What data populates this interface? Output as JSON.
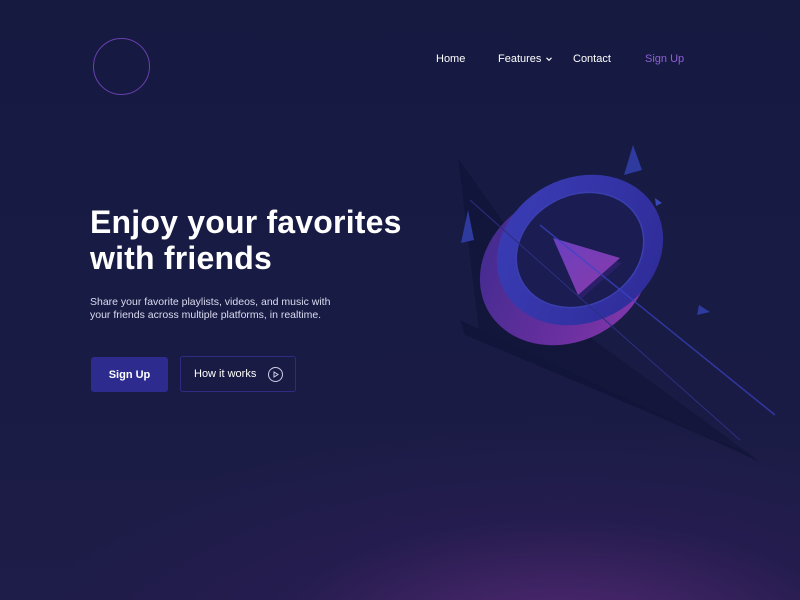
{
  "nav": {
    "home": "Home",
    "features": "Features",
    "contact": "Contact",
    "signup": "Sign Up"
  },
  "hero": {
    "title_line1": "Enjoy your favorites",
    "title_line2": "with friends",
    "description": "Share your favorite playlists, videos, and music with your friends across multiple platforms, in realtime.",
    "primary_button": "Sign Up",
    "secondary_button": "How it works"
  },
  "icons": {
    "logo": "circle-ring-logo",
    "features_dropdown": "chevron-down-icon",
    "how_it_works": "play-circle-icon",
    "illustration": "3d-play-button"
  },
  "colors": {
    "background": "#161a40",
    "accent": "#8f5fd6",
    "primary_button": "#2e2b8f",
    "logo_ring": "#6a3fb0"
  }
}
